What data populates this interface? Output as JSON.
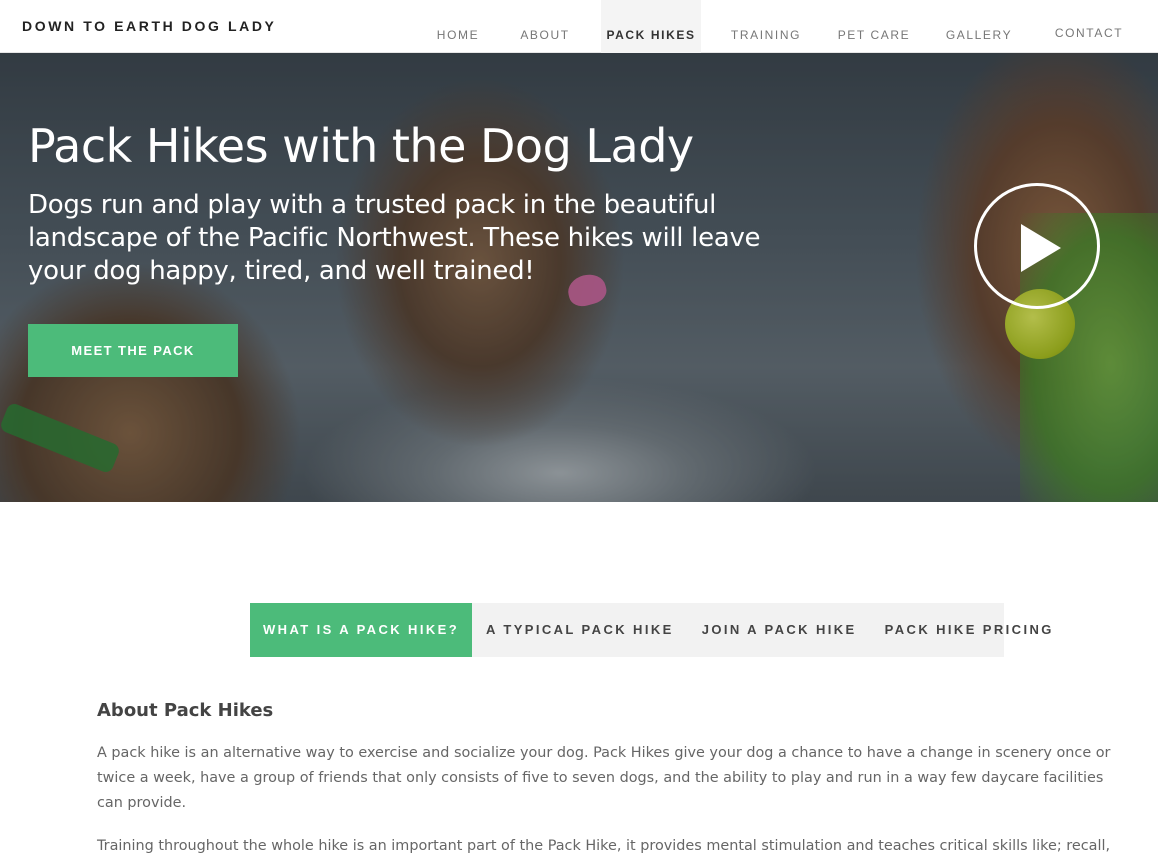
{
  "header": {
    "brand": "DOWN TO EARTH DOG LADY",
    "nav": [
      {
        "label": "HOME"
      },
      {
        "label": "ABOUT"
      },
      {
        "label": "PACK HIKES",
        "active": true
      },
      {
        "label": "TRAINING"
      },
      {
        "label": "PET CARE"
      },
      {
        "label": "GALLERY"
      },
      {
        "label": "CONTACT"
      }
    ]
  },
  "hero": {
    "title": "Pack Hikes with the Dog Lady",
    "subtitle": "Dogs run and play with a trusted pack in the beautiful landscape of the Pacific Northwest. These hikes will leave your dog happy, tired, and well trained!",
    "cta_label": "MEET THE PACK",
    "play_icon": "play-icon",
    "accent_color": "#4cbb7a"
  },
  "tabs": [
    {
      "label": "WHAT IS A PACK HIKE?",
      "active": true
    },
    {
      "label": "A TYPICAL PACK HIKE"
    },
    {
      "label": "JOIN A PACK HIKE"
    },
    {
      "label": "PACK HIKE PRICING"
    }
  ],
  "content": {
    "title": "About Pack Hikes",
    "paragraphs": [
      "A pack hike is an alternative way to exercise and socialize your dog. Pack Hikes give your dog a chance to have a change in scenery once or twice a week, have a group of friends that only consists of five to seven dogs, and the ability to play and run in a way few daycare facilities can provide.",
      "Training throughout the whole hike is an important part of the Pack Hike, it provides mental stimulation and teaches critical skills like; recall, proper ways to meet new dogs, manners for meeting strangers, and appropriate play amongst the pack members."
    ]
  }
}
